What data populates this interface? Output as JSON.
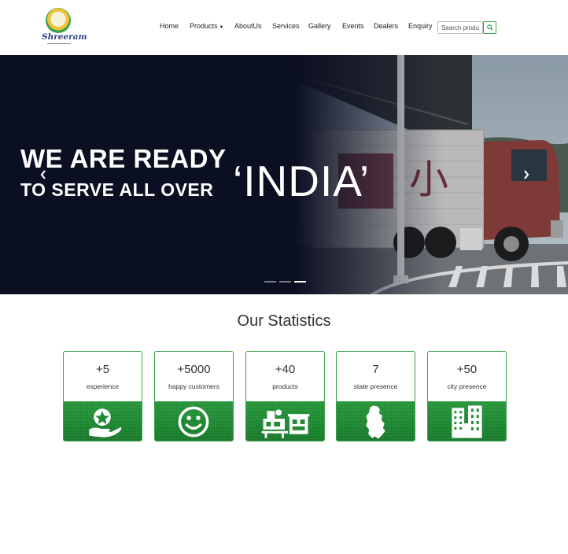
{
  "brand": {
    "logo_text": "Shreeram"
  },
  "nav": {
    "items": [
      {
        "label": "Home"
      },
      {
        "label": "Products"
      },
      {
        "label": "AboutUs"
      },
      {
        "label": "Services"
      },
      {
        "label": "Gallery"
      },
      {
        "label": "Events"
      },
      {
        "label": "Dealers"
      },
      {
        "label": "Enquiry"
      }
    ],
    "search_placeholder": "Search product",
    "search_icon": "search-icon",
    "dropdown_icon": "caret-down-icon"
  },
  "hero": {
    "line1": "WE ARE READY",
    "line2": "TO SERVE ALL OVER",
    "highlight": "‘INDIA’",
    "prev_icon": "chevron-left-icon",
    "next_icon": "chevron-right-icon",
    "slide_count": 3,
    "active_slide": 3
  },
  "stats": {
    "title": "Our Statistics",
    "items": [
      {
        "value": "+5",
        "label": "experience",
        "icon": "hand-star-icon"
      },
      {
        "value": "+5000",
        "label": "happy customers",
        "icon": "smiley-icon"
      },
      {
        "value": "+40",
        "label": "products",
        "icon": "machinery-icon"
      },
      {
        "value": "7",
        "label": "state presence",
        "icon": "map-region-icon"
      },
      {
        "value": "+50",
        "label": "city presence",
        "icon": "buildings-icon"
      }
    ]
  },
  "colors": {
    "accent": "#3aa34a",
    "hero_dark": "#0b0f22"
  }
}
